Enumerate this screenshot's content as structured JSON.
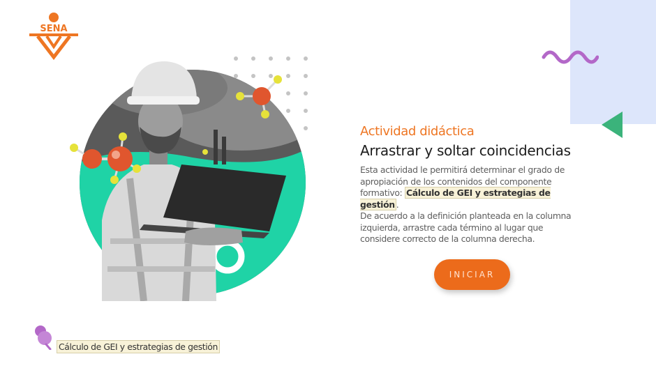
{
  "brand": {
    "logo_text": "SENA",
    "accent": "#ee7623"
  },
  "activity": {
    "eyebrow": "Actividad didáctica",
    "title": "Arrastrar y soltar coincidencias",
    "intro_before": "Esta actividad le permitirá determinar el grado de apropiación de los contenidos del componente formativo: ",
    "intro_highlight": "Cálculo de GEI y estrategias de gestión",
    "intro_after": ".",
    "instructions": "De acuerdo a la definición planteada en la columna izquierda, arrastre cada término al lugar que considere correcto de la columna derecha.",
    "start_button": "INICIAR"
  },
  "footer": {
    "component_label": "Cálculo de GEI y estrategias de gestión"
  },
  "colors": {
    "orange": "#ec6b1b",
    "teal": "#1fd3a6",
    "green": "#3bb37b",
    "purple": "#b368c8",
    "light_blue": "#dde6fb"
  },
  "icons": [
    "sena-logo",
    "molecule-icon",
    "pin-icon"
  ]
}
